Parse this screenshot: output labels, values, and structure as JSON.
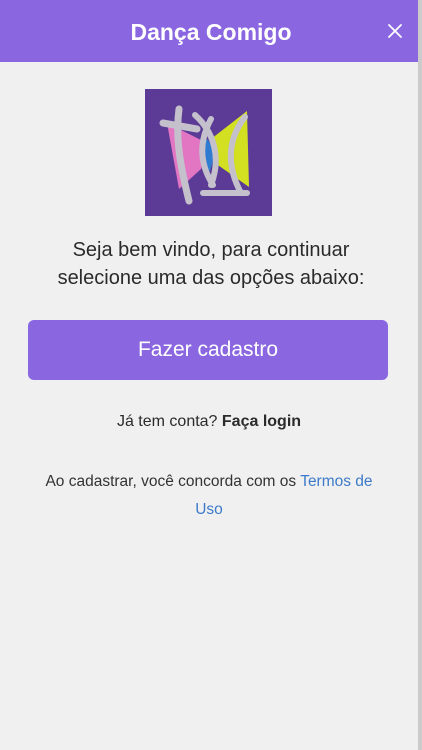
{
  "header": {
    "title": "Dança Comigo"
  },
  "welcome": {
    "line1": "Seja bem vindo, para continuar",
    "line2": "selecione uma das opções abaixo:"
  },
  "signup_button": {
    "label": "Fazer cadastro"
  },
  "login": {
    "prompt": "Já tem conta?",
    "link_label": "Faça login"
  },
  "terms": {
    "text": "Ao cadastrar, você concorda com os",
    "link_label": "Termos de Uso"
  },
  "colors": {
    "accent": "#8a67e0",
    "link": "#3c7ac9",
    "background": "#f0f0f1",
    "logo_background": "#5b3b96"
  },
  "icons": {
    "close": "close-icon",
    "logo": "app-logo"
  }
}
